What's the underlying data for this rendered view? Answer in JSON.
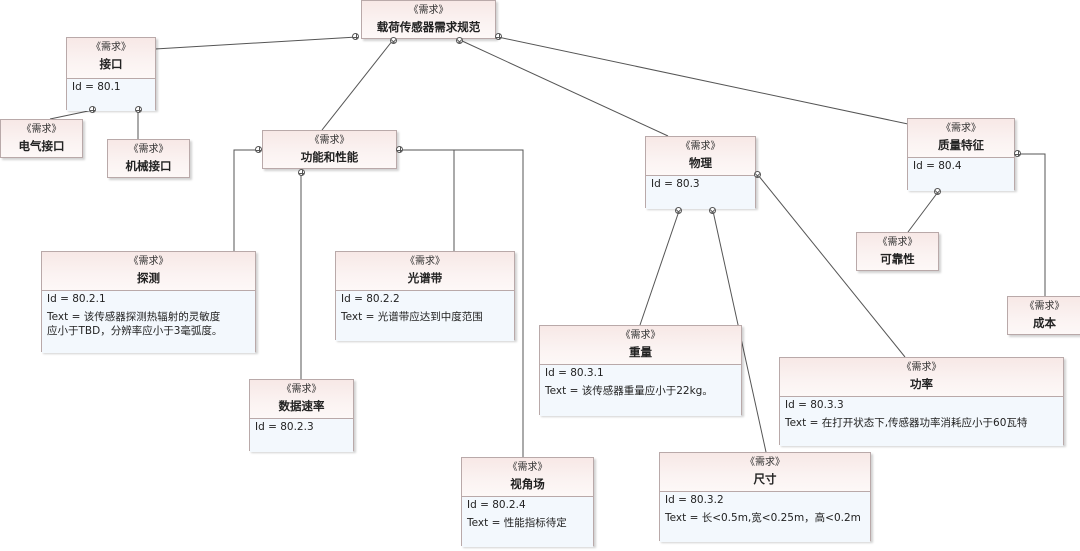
{
  "diagram": {
    "stereotype": "《需求》",
    "nodes": {
      "root": {
        "title": "载荷传感器需求规范"
      },
      "interface": {
        "title": "接口",
        "id": "Id = 80.1"
      },
      "electrical": {
        "title": "电气接口"
      },
      "mechanical": {
        "title": "机械接口"
      },
      "function": {
        "title": "功能和性能"
      },
      "detection": {
        "title": "探测",
        "id": "Id = 80.2.1",
        "text": "Text = 该传感器探测热辐射的灵敏度\n应小于TBD，分辨率应小于3毫弧度。"
      },
      "spectrum": {
        "title": "光谱带",
        "id": "Id = 80.2.2",
        "text": "Text = 光谱带应达到中度范围"
      },
      "datarate": {
        "title": "数据速率",
        "id": "Id = 80.2.3"
      },
      "fov": {
        "title": "视角场",
        "id": "Id = 80.2.4",
        "text": "Text = 性能指标待定"
      },
      "physical": {
        "title": "物理",
        "id": "Id = 80.3"
      },
      "weight": {
        "title": "重量",
        "id": "Id = 80.3.1",
        "text": "Text = 该传感器重量应小于22kg。"
      },
      "size": {
        "title": "尺寸",
        "id": "Id = 80.3.2",
        "text": "Text = 长<0.5m,宽<0.25m，高<0.2m"
      },
      "power": {
        "title": "功率",
        "id": "Id = 80.3.3",
        "text": "Text = 在打开状态下,传感器功率消耗应小于60瓦特"
      },
      "quality": {
        "title": "质量特征",
        "id": "Id = 80.4"
      },
      "reliability": {
        "title": "可靠性"
      },
      "cost": {
        "title": "成本"
      }
    },
    "relations": [
      {
        "from": "root",
        "to": "interface",
        "type": "containment"
      },
      {
        "from": "root",
        "to": "function",
        "type": "containment"
      },
      {
        "from": "root",
        "to": "physical",
        "type": "containment"
      },
      {
        "from": "root",
        "to": "quality",
        "type": "containment"
      },
      {
        "from": "interface",
        "to": "electrical",
        "type": "containment"
      },
      {
        "from": "interface",
        "to": "mechanical",
        "type": "containment"
      },
      {
        "from": "function",
        "to": "detection",
        "type": "containment"
      },
      {
        "from": "function",
        "to": "spectrum",
        "type": "containment"
      },
      {
        "from": "function",
        "to": "datarate",
        "type": "containment"
      },
      {
        "from": "function",
        "to": "fov",
        "type": "containment"
      },
      {
        "from": "physical",
        "to": "weight",
        "type": "containment"
      },
      {
        "from": "physical",
        "to": "size",
        "type": "containment"
      },
      {
        "from": "physical",
        "to": "power",
        "type": "containment"
      },
      {
        "from": "quality",
        "to": "reliability",
        "type": "containment"
      },
      {
        "from": "quality",
        "to": "cost",
        "type": "containment"
      }
    ]
  }
}
